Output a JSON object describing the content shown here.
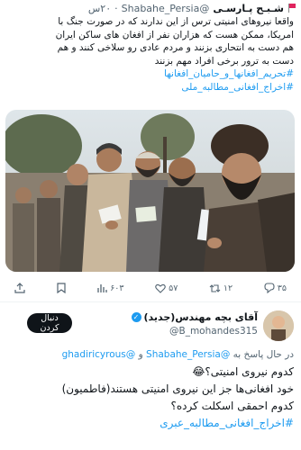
{
  "tweet": {
    "name": "شـبـح پـارسـی",
    "handle": "@Shabahe_Persia",
    "time": "۲۰س",
    "body_lines": [
      "واقعا نیروهای امنیتی ترس از این ندارند که در صورت جنگ با",
      "امریکا، ممکن هست که هزاران نفر از افغان های ساکن ایران",
      "هم دست به انتحاری بزنند و مردم عادی رو سلاخی کنند و هم",
      "دست به ترور برخی افراد مهم بزنند"
    ],
    "hashtags": [
      "#تحریم_افغانها_و_حامیان_افغانها",
      "#اخراج_افغانی_مطالبه_ملی"
    ],
    "stats": {
      "views": "۶۰۳",
      "likes": "۵۷",
      "retweets": "۱۲",
      "replies": "۳۵"
    }
  },
  "reply": {
    "name": "آقای بچه مهندس(جدید)",
    "handle": "@B_mohandes315",
    "follow_label": "دنبال کردن",
    "replying_prefix": "در حال پاسخ به",
    "replying_user1": "@Shabahe_Persia",
    "replying_joiner": "و",
    "replying_user2": "@ghadiricyrous",
    "line1": "کدوم نیروی امنیتی؟😂",
    "line2": "خود افغانی‌ها جز این نیروی امنیتی هستند(فاطمیون)",
    "line3": "کدوم احمقی اسکلت کرده؟",
    "hashtag": "#اخراج_افغانی_مطالبه_عبری"
  }
}
